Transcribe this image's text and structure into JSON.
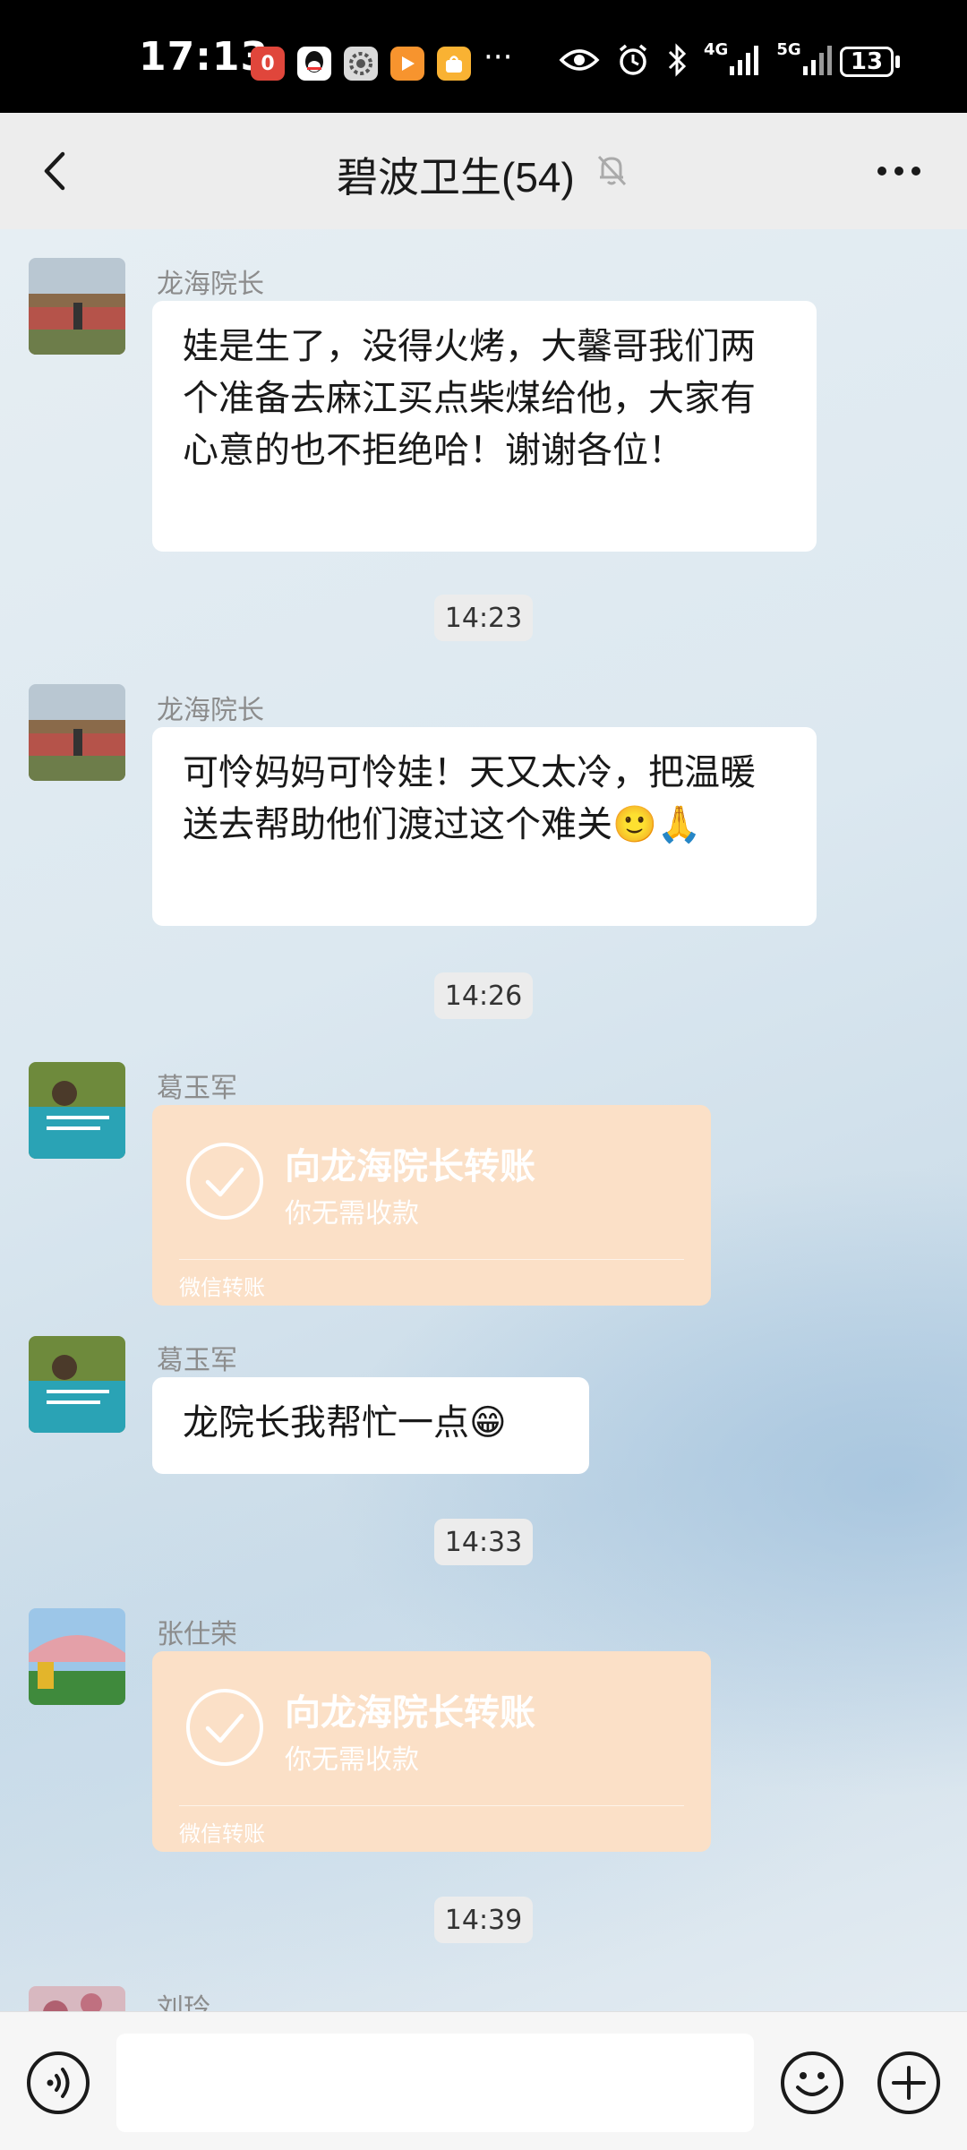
{
  "status_bar": {
    "time": "17:13",
    "app_icons": [
      "notification-badge-icon",
      "qq-icon",
      "settings-app-icon",
      "video-app-icon",
      "store-app-icon"
    ],
    "more": "···",
    "network_1": "4G",
    "network_2": "5G",
    "battery": "13"
  },
  "header": {
    "title": "碧波卫生(54)"
  },
  "messages": [
    {
      "sender": "龙海院长",
      "text": "娃是生了，没得火烤，大馨哥我们两个准备去麻江买点柴煤给他，大家有心意的也不拒绝哈！谢谢各位！"
    },
    {
      "time": "14:23"
    },
    {
      "sender": "龙海院长",
      "text": "可怜妈妈可怜娃！天又太冷，把温暖送去帮助他们渡过这个难关🙂🙏"
    },
    {
      "time": "14:26"
    },
    {
      "sender": "葛玉军",
      "transfer_title": "向龙海院长转账",
      "transfer_sub": "你无需收款",
      "transfer_footer": "微信转账"
    },
    {
      "sender": "葛玉军",
      "text": "龙院长我帮忙一点😁"
    },
    {
      "time": "14:33"
    },
    {
      "sender": "张仕荣",
      "transfer_title": "向龙海院长转账",
      "transfer_sub": "你无需收款",
      "transfer_footer": "微信转账"
    },
    {
      "time": "14:39"
    },
    {
      "sender": "刘玲"
    }
  ],
  "colors": {
    "statusbar_bg": "#000000",
    "header_bg": "#ededed",
    "transfer_bg": "#fbe0c7",
    "bubble_bg": "#ffffff"
  }
}
